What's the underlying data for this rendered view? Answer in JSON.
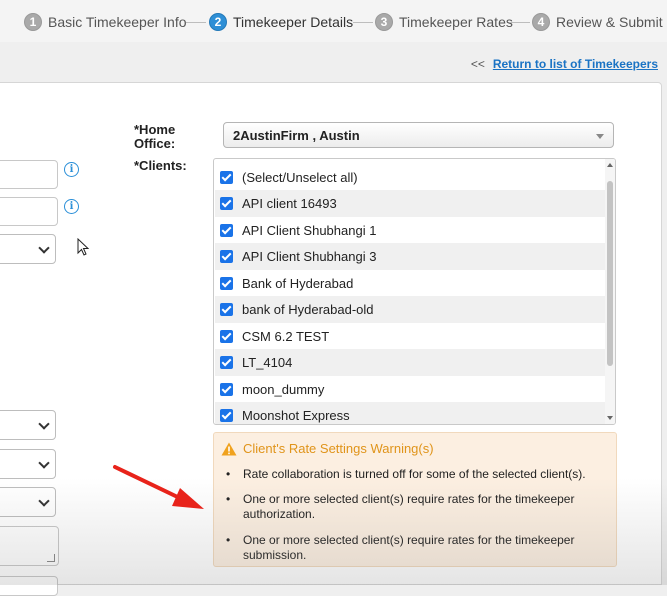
{
  "wizard": {
    "steps": [
      {
        "num": "1",
        "label": "Basic Timekeeper Info",
        "active": false
      },
      {
        "num": "2",
        "label": "Timekeeper Details",
        "active": true
      },
      {
        "num": "3",
        "label": "Timekeeper Rates",
        "active": false
      },
      {
        "num": "4",
        "label": "Review & Submit",
        "active": false
      }
    ]
  },
  "nav": {
    "return_prefix": "<<",
    "return_label": "Return to list of Timekeepers"
  },
  "form": {
    "home_office": {
      "label": "*Home Office:",
      "label_line1": "*Home",
      "label_line2": "Office:",
      "value": "2AustinFirm , Austin"
    },
    "clients": {
      "label": "*Clients:",
      "items": [
        {
          "label": "(Select/Unselect all)",
          "checked": true
        },
        {
          "label": "API client 16493",
          "checked": true
        },
        {
          "label": "API Client Shubhangi 1",
          "checked": true
        },
        {
          "label": "API Client Shubhangi 3",
          "checked": true
        },
        {
          "label": "Bank of Hyderabad",
          "checked": true
        },
        {
          "label": "bank of Hyderabad-old",
          "checked": true
        },
        {
          "label": "CSM 6.2 TEST",
          "checked": true
        },
        {
          "label": "LT_4104",
          "checked": true
        },
        {
          "label": "moon_dummy",
          "checked": true
        },
        {
          "label": "Moonshot Express",
          "checked": true
        }
      ]
    }
  },
  "warning": {
    "title": "Client's Rate Settings Warning(s)",
    "items": [
      "Rate collaboration is turned off for some of the selected client(s).",
      "One or more selected client(s) require rates for the timekeeper authorization.",
      "One or more selected client(s) require rates for the timekeeper submission."
    ]
  },
  "colors": {
    "accent": "#2e8fd6",
    "link": "#1a73c4",
    "checkbox": "#1a73e8",
    "warning_bg": "#fcefe1",
    "warning_title": "#e0941a",
    "annotation_arrow": "#e8231a"
  },
  "icons": {
    "info": "info-icon",
    "warning": "warning-icon",
    "pointer": "cursor-icon"
  }
}
